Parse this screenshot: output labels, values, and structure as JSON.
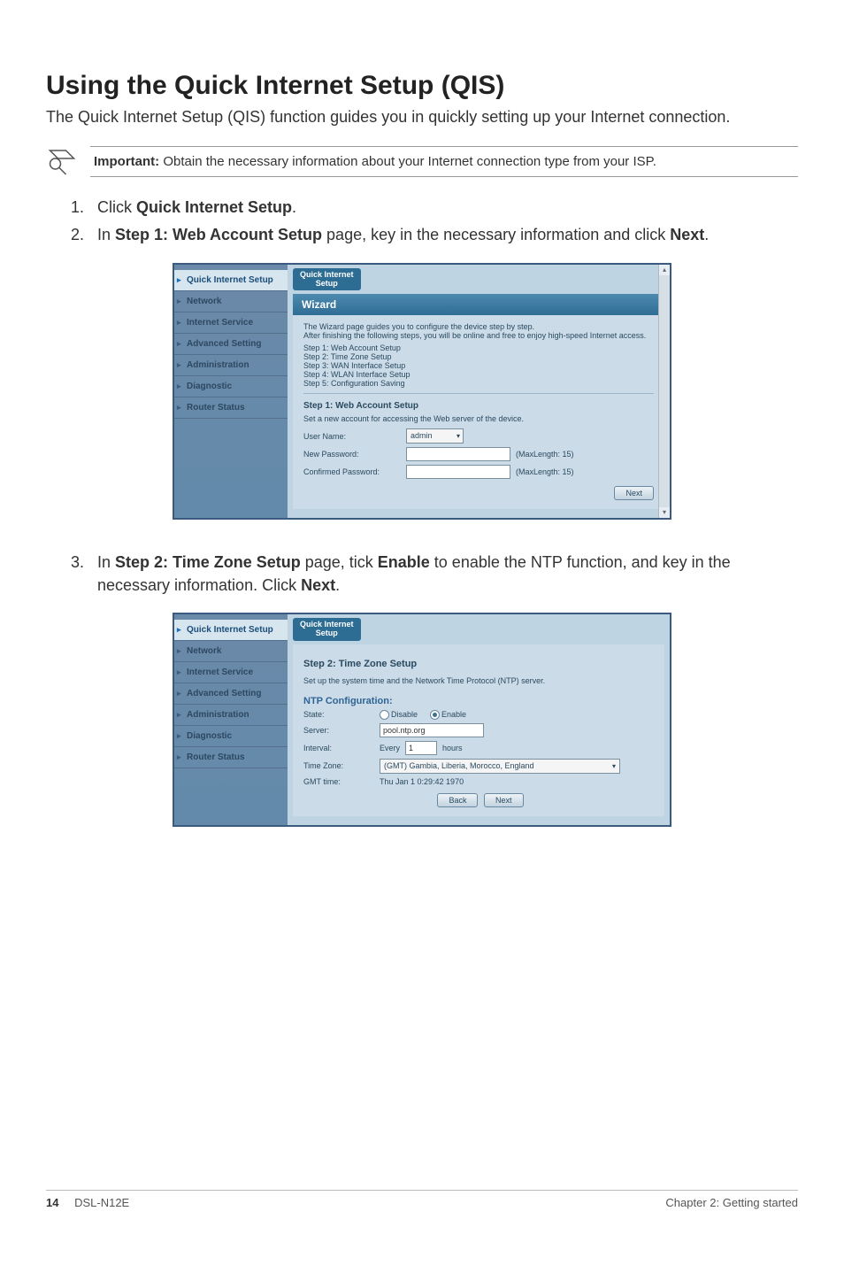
{
  "title": "Using the Quick Internet Setup (QIS)",
  "intro": "The Quick Internet Setup (QIS) function guides you in quickly setting up your Internet connection.",
  "note": {
    "label": "Important:",
    "text": "  Obtain the necessary information about your Internet connection type from your ISP."
  },
  "steps": {
    "s1": {
      "pre": "Click ",
      "b1": "Quick Internet Setup",
      "post": "."
    },
    "s2": {
      "pre": "In ",
      "b1": "Step 1: Web Account Setup",
      "mid": " page, key in the necessary information and click ",
      "b2": "Next",
      "post": "."
    },
    "s3": {
      "pre": "In ",
      "b1": "Step 2: Time Zone Setup",
      "mid1": " page, tick ",
      "b2": "Enable",
      "mid2": " to enable the NTP function, and key in the necessary information. Click ",
      "b3": "Next",
      "post": "."
    }
  },
  "router": {
    "tab": "Quick Internet\nSetup",
    "sidebar": [
      "Quick Internet Setup",
      "Network",
      "Internet Service",
      "Advanced Setting",
      "Administration",
      "Diagnostic",
      "Router Status"
    ],
    "shot1": {
      "wizardTitle": "Wizard",
      "desc1": "The Wizard page guides you to configure the device step by step.",
      "desc2": "After finishing the following steps, you will be online and free to enjoy high-speed Internet access.",
      "stepsList": [
        "Step 1: Web Account Setup",
        "Step 2: Time Zone Setup",
        "Step 3: WAN Interface Setup",
        "Step 4: WLAN Interface Setup",
        "Step 5: Configuration Saving"
      ],
      "stepHeading": "Step 1: Web Account Setup",
      "stepDesc": "Set a new account for accessing the Web server of the device.",
      "fields": {
        "userName": {
          "label": "User Name:",
          "value": "admin"
        },
        "newPassword": {
          "label": "New Password:",
          "hint": "(MaxLength: 15)"
        },
        "confirmPassword": {
          "label": "Confirmed Password:",
          "hint": "(MaxLength: 15)"
        }
      },
      "buttons": {
        "next": "Next"
      }
    },
    "shot2": {
      "stepHeading": "Step 2: Time Zone Setup",
      "stepDesc": "Set up the system time and the Network Time Protocol (NTP) server.",
      "ntpHeading": "NTP Configuration:",
      "fields": {
        "state": {
          "label": "State:",
          "opt1": "Disable",
          "opt2": "Enable"
        },
        "server": {
          "label": "Server:",
          "value": "pool.ntp.org"
        },
        "interval": {
          "label": "Interval:",
          "prefix": "Every",
          "value": "1",
          "suffix": "hours"
        },
        "tz": {
          "label": "Time Zone:",
          "value": "(GMT) Gambia, Liberia, Morocco, England"
        },
        "gmt": {
          "label": "GMT time:",
          "value": "Thu Jan 1 0:29:42 1970"
        }
      },
      "buttons": {
        "back": "Back",
        "next": "Next"
      }
    }
  },
  "footer": {
    "pageNum": "14",
    "model": "DSL-N12E",
    "chapter": "Chapter 2: Getting started"
  }
}
